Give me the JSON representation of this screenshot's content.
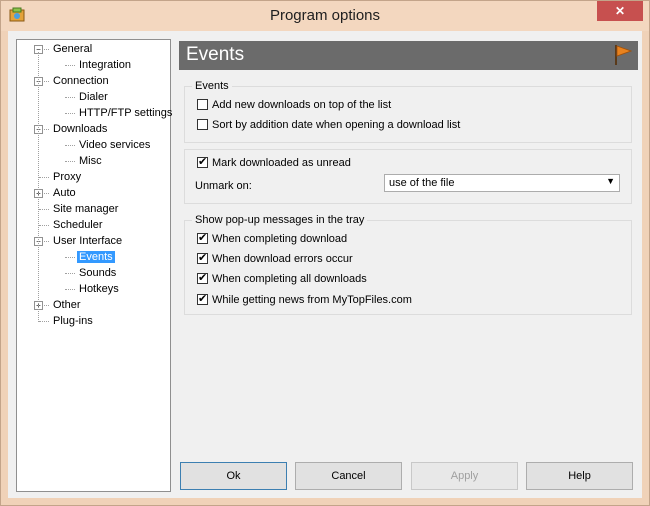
{
  "window": {
    "title": "Program options",
    "close_glyph": "✕"
  },
  "tree": {
    "items": [
      {
        "label": "General",
        "level": 0,
        "expander": "−"
      },
      {
        "label": "Integration",
        "level": 1
      },
      {
        "label": "Connection",
        "level": 0,
        "expander": "−"
      },
      {
        "label": "Dialer",
        "level": 1
      },
      {
        "label": "HTTP/FTP settings",
        "level": 1
      },
      {
        "label": "Downloads",
        "level": 0,
        "expander": "−"
      },
      {
        "label": "Video services",
        "level": 1
      },
      {
        "label": "Misc",
        "level": 1
      },
      {
        "label": "Proxy",
        "level": 0
      },
      {
        "label": "Auto",
        "level": 0,
        "expander": "+"
      },
      {
        "label": "Site manager",
        "level": 0
      },
      {
        "label": "Scheduler",
        "level": 0
      },
      {
        "label": "User Interface",
        "level": 0,
        "expander": "−"
      },
      {
        "label": "Events",
        "level": 1,
        "selected": true
      },
      {
        "label": "Sounds",
        "level": 1
      },
      {
        "label": "Hotkeys",
        "level": 1
      },
      {
        "label": "Other",
        "level": 0,
        "expander": "+"
      },
      {
        "label": "Plug-ins",
        "level": 0
      }
    ]
  },
  "header": {
    "title": "Events",
    "icon": "flag-icon"
  },
  "events_group": {
    "title": "Events",
    "options": [
      {
        "label": "Add new downloads on top of the list",
        "checked": false
      },
      {
        "label": "Sort by addition date when opening a download list",
        "checked": false
      }
    ]
  },
  "unread_group": {
    "mark_label": "Mark downloaded as unread",
    "mark_checked": true,
    "unmark_label": "Unmark on:",
    "unmark_value": "use of the file"
  },
  "popup_group": {
    "title": "Show pop-up messages in the tray",
    "options": [
      {
        "label": "When completing download",
        "checked": true
      },
      {
        "label": "When download errors occur",
        "checked": true
      },
      {
        "label": "When completing all downloads",
        "checked": true
      },
      {
        "label": "While getting news from MyTopFiles.com",
        "checked": true
      }
    ]
  },
  "buttons": {
    "ok": "Ok",
    "cancel": "Cancel",
    "apply": "Apply",
    "help": "Help"
  },
  "colors": {
    "header_bg": "#6b6b6b",
    "selection": "#3399ff",
    "titlebar": "#f3d7bf",
    "close": "#c7504f",
    "flag": "#e8821e"
  }
}
